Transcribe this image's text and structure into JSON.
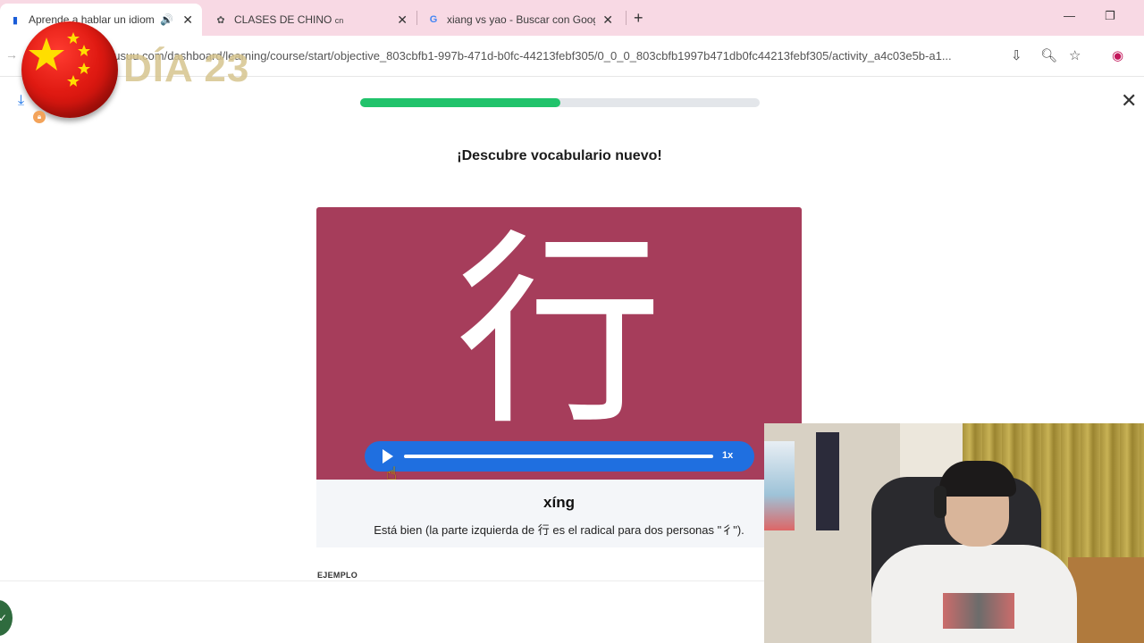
{
  "browser": {
    "tabs": [
      {
        "title": "Aprende a hablar un idioma",
        "active": true,
        "favicon": "busuu-icon",
        "audio": true
      },
      {
        "title": "CLASES DE CHINO",
        "suffix": "cn",
        "active": false,
        "favicon": "chatgpt-icon"
      },
      {
        "title": "xiang vs yao - Buscar con Goog",
        "active": false,
        "favicon": "google-icon"
      }
    ],
    "close_glyph": "✕",
    "new_tab_glyph": "+",
    "url": "busuu.com/dashboard/learning/course/start/objective_803cbfb1-997b-471d-b0fc-44213febf305/0_0_0_803cbfb1997b471db0fc44213febf305/activity_a4c03e5b-a1..."
  },
  "overlay": {
    "day_label": "DÍA 23"
  },
  "lesson": {
    "progress_fraction": 0.5,
    "heading": "¡Descubre vocabulario nuevo!",
    "character": "行",
    "audio_speed": "1x",
    "pinyin": "xíng",
    "meaning": "Está bien (la parte izquierda de 行 es el radical para dos personas \"彳\").",
    "example_label": "EJEMPLO"
  },
  "colors": {
    "card_bg": "#a63d5b",
    "player_bg": "#1f6fe0",
    "progress_fill": "#21c36b",
    "tab_strip": "#f8d9e4"
  }
}
